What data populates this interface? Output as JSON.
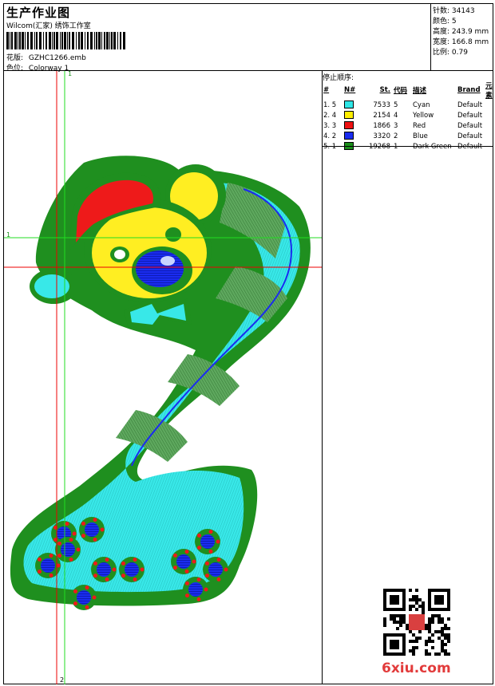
{
  "header": {
    "title": "生产作业图",
    "subtitle": "Wilcom(汇家) 绣饰工作室",
    "design_label": "花版:",
    "design_value": "GZHC1266.emb",
    "colorway_label": "色位:",
    "colorway_value": "Colorway 1"
  },
  "stats": [
    {
      "label": "针数:",
      "value": "34143"
    },
    {
      "label": "颜色:",
      "value": "5"
    },
    {
      "label": "高度:",
      "value": "243.9 mm"
    },
    {
      "label": "宽度:",
      "value": "166.8 mm"
    },
    {
      "label": "比例:",
      "value": "0.79"
    }
  ],
  "stop_sequence": {
    "title": "停止顺序:",
    "columns": [
      "#",
      "N#",
      "St.",
      "代码",
      "描述",
      "Brand",
      "元素"
    ],
    "rows": [
      {
        "idx": "1. 5",
        "color": "#2ee6e6",
        "st": "7533",
        "code": "5",
        "desc": "Cyan",
        "brand": "Default"
      },
      {
        "idx": "2. 4",
        "color": "#ffee00",
        "st": "2154",
        "code": "4",
        "desc": "Yellow",
        "brand": "Default"
      },
      {
        "idx": "3. 3",
        "color": "#ee1111",
        "st": "1866",
        "code": "3",
        "desc": "Red",
        "brand": "Default"
      },
      {
        "idx": "4. 2",
        "color": "#1a2cf0",
        "st": "3320",
        "code": "2",
        "desc": "Blue",
        "brand": "Default"
      },
      {
        "idx": "5. 1",
        "color": "#1a8f1a",
        "st": "19268",
        "code": "1",
        "desc": "Dark Green",
        "brand": "Default"
      }
    ]
  },
  "guides": {
    "mark_top": "1",
    "mark_left": "1",
    "mark_bottom": "2"
  },
  "watermark": {
    "text": "6xiu.com"
  }
}
